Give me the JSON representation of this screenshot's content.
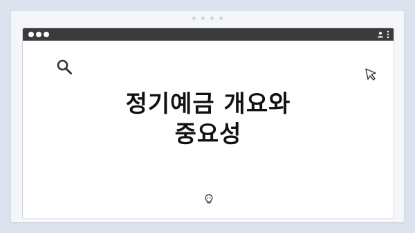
{
  "window": {
    "controls": [
      "close",
      "minimize",
      "maximize"
    ],
    "icons": {
      "account": "user-icon",
      "menu": "kebab-icon"
    }
  },
  "content": {
    "headline_line1": "정기예금 개요와",
    "headline_line2": "중요성",
    "decorations": [
      "search-icon",
      "cursor-icon",
      "lightbulb-icon"
    ]
  },
  "colors": {
    "background": "#dde3ec",
    "titlebar": "#3b3b3b",
    "window": "#ffffff",
    "text": "#111111"
  }
}
